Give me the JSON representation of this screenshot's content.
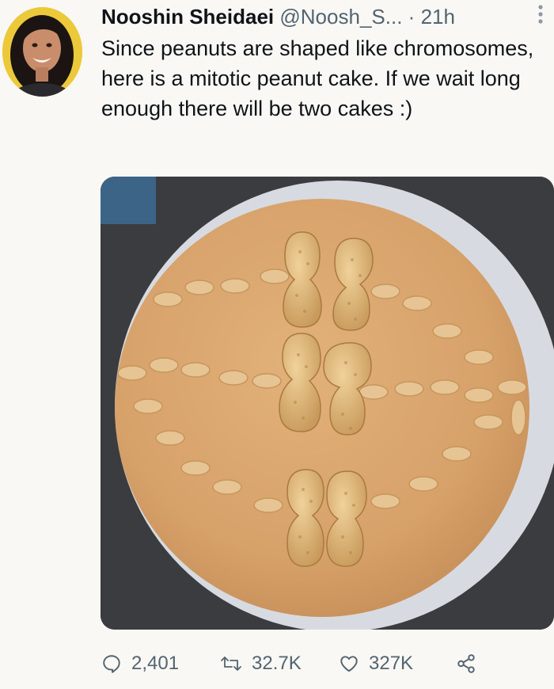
{
  "tweet": {
    "author_name": "Nooshin Sheidaei",
    "handle": "@Noosh_S...",
    "separator": "·",
    "time": "21h",
    "text": "Since peanuts are shaped like chromosomes, here is a mitotic peanut cake. If we wait long enough there will be two cakes :)"
  },
  "metrics": {
    "replies": "2,401",
    "retweets": "32.7K",
    "likes": "327K"
  },
  "icons": {
    "reply": "reply-icon",
    "retweet": "retweet-icon",
    "like": "heart-icon",
    "share": "share-icon",
    "more": "more-options-icon"
  },
  "colors": {
    "background": "#f9f8f4",
    "text": "#0f1419",
    "muted": "#536471",
    "frosting": "#d9a56b",
    "plate": "#d9dde3"
  }
}
